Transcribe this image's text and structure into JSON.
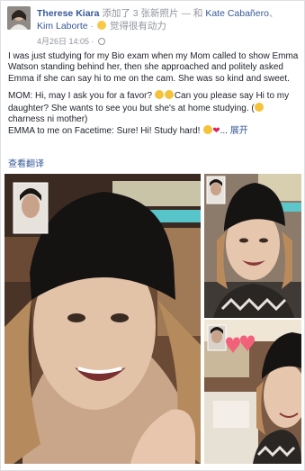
{
  "header": {
    "author": "Therese Kiara",
    "action": " 添加了 3 张新照片 — 和 ",
    "tagged1": "Kate Cabañero",
    "separator": "、",
    "tagged2": "Kim Laborte",
    "feeling_sep": " · ",
    "feeling": " 觉得很有动力",
    "date": "4月26日 14:05 · "
  },
  "post": {
    "para1": "I was just studying for my Bio exam when my Mom called to show Emma Watson standing behind her, then she approached and politely asked Emma if she can say hi to me on the cam. She was so kind and sweet.",
    "para2a": "MOM: Hi, may I ask you for a favor? ",
    "para2b": "Can you please say Hi to my daughter? She wants to see you but she's at home studying. (",
    "para2c": "charness ni mother)",
    "para3a": "EMMA to me on Facetime: Sure! Hi! Study hard! ",
    "ellipsis": "... ",
    "see_more": "展开",
    "translate": "查看翻译"
  },
  "colors": {
    "link": "#365899",
    "meta": "#90949c",
    "text": "#1d2129"
  },
  "icons": {
    "feeling": "smiley-icon",
    "privacy": "globe-icon",
    "heart": "heart-icon"
  }
}
